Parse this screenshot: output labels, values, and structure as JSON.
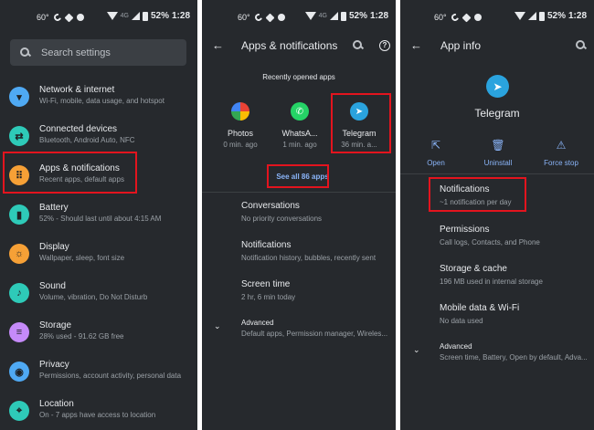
{
  "status": {
    "temp": "60°",
    "battery": "52%",
    "time": "1:28",
    "net": "4G"
  },
  "panel1": {
    "search_placeholder": "Search settings",
    "items": [
      {
        "title": "Network & internet",
        "sub": "Wi-Fi, mobile, data usage, and hotspot",
        "color": "#4fa9f3",
        "icon": "wifi-icon"
      },
      {
        "title": "Connected devices",
        "sub": "Bluetooth, Android Auto, NFC",
        "color": "#2ecab8",
        "icon": "devices-icon"
      },
      {
        "title": "Apps & notifications",
        "sub": "Recent apps, default apps",
        "color": "#f6a036",
        "icon": "apps-icon"
      },
      {
        "title": "Battery",
        "sub": "52% - Should last until about 4:15 AM",
        "color": "#2ecab8",
        "icon": "battery-icon"
      },
      {
        "title": "Display",
        "sub": "Wallpaper, sleep, font size",
        "color": "#f6a036",
        "icon": "display-icon"
      },
      {
        "title": "Sound",
        "sub": "Volume, vibration, Do Not Disturb",
        "color": "#2ecab8",
        "icon": "sound-icon"
      },
      {
        "title": "Storage",
        "sub": "28% used - 91.62 GB free",
        "color": "#c58af9",
        "icon": "storage-icon"
      },
      {
        "title": "Privacy",
        "sub": "Permissions, account activity, personal data",
        "color": "#4fa9f3",
        "icon": "privacy-icon"
      },
      {
        "title": "Location",
        "sub": "On - 7 apps have access to location",
        "color": "#2ecab8",
        "icon": "location-icon"
      }
    ]
  },
  "panel2": {
    "title": "Apps & notifications",
    "recent_label": "Recently opened apps",
    "apps": [
      {
        "name": "Photos",
        "time": "0 min. ago"
      },
      {
        "name": "WhatsA...",
        "time": "1 min. ago"
      },
      {
        "name": "Telegram",
        "time": "36 min. a..."
      }
    ],
    "see_all": "See all 86 apps",
    "items": [
      {
        "title": "Conversations",
        "sub": "No priority conversations"
      },
      {
        "title": "Notifications",
        "sub": "Notification history, bubbles, recently sent"
      },
      {
        "title": "Screen time",
        "sub": "2 hr, 6 min today"
      },
      {
        "title": "Advanced",
        "sub": "Default apps, Permission manager, Wireles..."
      }
    ]
  },
  "panel3": {
    "title": "App info",
    "app_name": "Telegram",
    "actions": [
      {
        "label": "Open",
        "icon": "open-icon"
      },
      {
        "label": "Uninstall",
        "icon": "trash-icon"
      },
      {
        "label": "Force stop",
        "icon": "warning-icon"
      }
    ],
    "items": [
      {
        "title": "Notifications",
        "sub": "~1 notification per day"
      },
      {
        "title": "Permissions",
        "sub": "Call logs, Contacts, and Phone"
      },
      {
        "title": "Storage & cache",
        "sub": "196 MB used in internal storage"
      },
      {
        "title": "Mobile data & Wi-Fi",
        "sub": "No data used"
      },
      {
        "title": "Advanced",
        "sub": "Screen time, Battery, Open by default, Adva..."
      }
    ]
  }
}
